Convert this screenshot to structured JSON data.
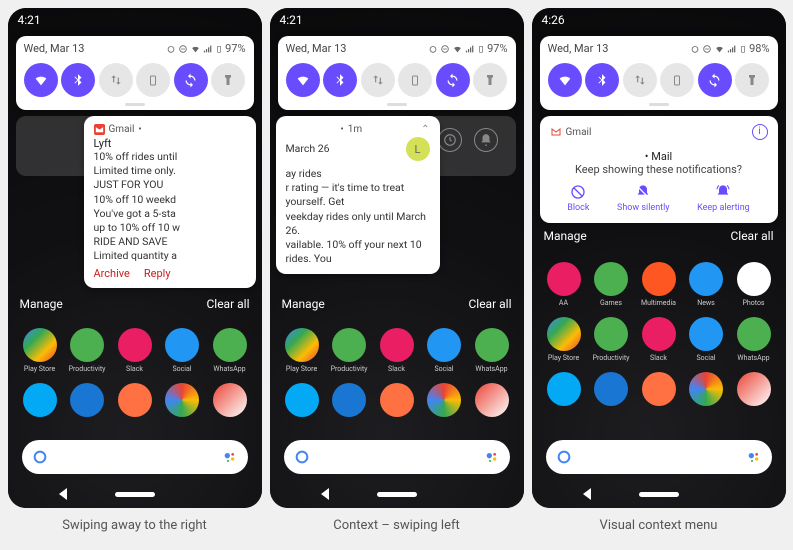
{
  "captions": [
    "Swiping away to the right",
    "Context – swiping left",
    "Visual context menu"
  ],
  "statusbar": {
    "time_a": "4:21",
    "time_c": "4:26"
  },
  "qs": {
    "date": "Wed, Mar 13",
    "battery_a": "97%",
    "battery_c": "98%",
    "tiles": [
      {
        "name": "wifi-icon",
        "on": true
      },
      {
        "name": "bluetooth-icon",
        "on": true
      },
      {
        "name": "swap-icon",
        "on": false
      },
      {
        "name": "battery-saver-icon",
        "on": false
      },
      {
        "name": "sync-icon",
        "on": true
      },
      {
        "name": "flashlight-icon",
        "on": false
      }
    ]
  },
  "notif1": {
    "app": "Gmail",
    "title": "Lyft",
    "lines": [
      "10% off rides until",
      "Limited time only.",
      "JUST FOR YOU",
      "10% off 10 weekd",
      "You've got a 5-sta",
      "up to 10% off 10 w",
      "RIDE AND SAVE",
      "Limited quantity a"
    ],
    "actions": {
      "archive": "Archive",
      "reply": "Reply"
    }
  },
  "notif2": {
    "time": "1m",
    "date_line": "March 26",
    "lines": [
      "ay rides",
      "r rating — it's time to treat yourself. Get",
      "veekday rides only until March 26.",
      "",
      "vailable. 10% off your next 10 rides. You"
    ]
  },
  "notif3": {
    "app": "Gmail",
    "category": "• Mail",
    "question": "Keep showing these notifications?",
    "actions": {
      "block": "Block",
      "silent": "Show silently",
      "keep": "Keep alerting"
    }
  },
  "shade": {
    "manage": "Manage",
    "clear": "Clear all"
  },
  "apps_row_top": [
    "AA",
    "Games",
    "Multimedia",
    "News",
    "Photos"
  ],
  "apps_row2": [
    "Play Store",
    "Productivity",
    "Slack",
    "Social",
    "WhatsApp"
  ],
  "colors": {
    "accent": "#6a4cff"
  }
}
